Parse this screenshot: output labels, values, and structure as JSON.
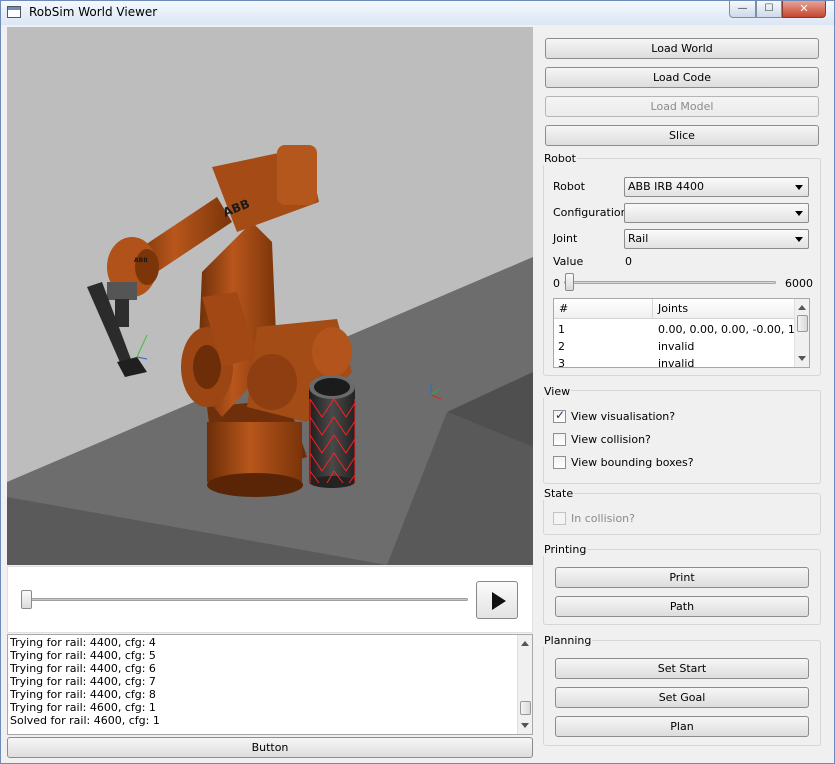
{
  "window": {
    "title": "RobSim World Viewer",
    "min_glyph": "—",
    "max_glyph": "☐",
    "close_glyph": "✕"
  },
  "log": {
    "lines": [
      "Trying for rail: 4400, cfg: 4",
      "Trying for rail: 4400, cfg: 5",
      "Trying for rail: 4400, cfg: 6",
      "Trying for rail: 4400, cfg: 7",
      "Trying for rail: 4400, cfg: 8",
      "Trying for rail: 4600, cfg: 1",
      "Solved for rail: 4600, cfg: 1"
    ]
  },
  "timeline": {
    "position": 0
  },
  "bottom_button_label": "Button",
  "side": {
    "load_world": "Load World",
    "load_code": "Load Code",
    "load_model": "Load Model",
    "slice": "Slice",
    "robot": {
      "title": "Robot",
      "robot_label": "Robot",
      "robot_value": "ABB IRB 4400",
      "configuration_label": "Configuration",
      "configuration_value": "",
      "joint_label": "Joint",
      "joint_value": "Rail",
      "value_label": "Value",
      "value_text": "0",
      "slider_min": "0",
      "slider_max": "6000",
      "table_headers": [
        "#",
        "Joints"
      ],
      "rows": [
        {
          "n": "1",
          "joints": "0.00, 0.00, 0.00, -0.00, 1..."
        },
        {
          "n": "2",
          "joints": "invalid"
        },
        {
          "n": "3",
          "joints": "invalid"
        }
      ]
    },
    "view": {
      "title": "View",
      "visualisation": "View visualisation?",
      "collision": "View collision?",
      "bounding": "View bounding boxes?"
    },
    "state": {
      "title": "State",
      "in_collision": "In collision?"
    },
    "printing": {
      "title": "Printing",
      "print": "Print",
      "path": "Path"
    },
    "planning": {
      "title": "Planning",
      "set_start": "Set Start",
      "set_goal": "Set Goal",
      "plan": "Plan"
    }
  },
  "robot_branding": "ABB"
}
